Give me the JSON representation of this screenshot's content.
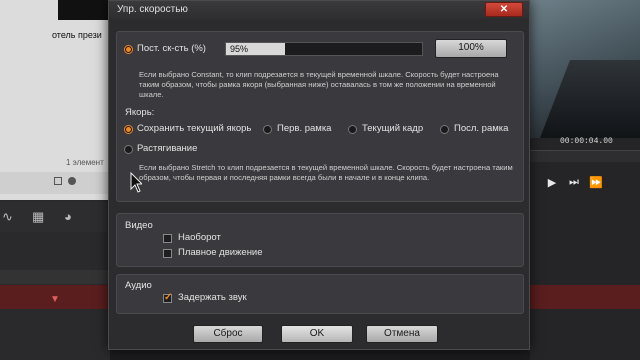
{
  "background": {
    "left_clip_title": "отель прези",
    "left_count": "1 элемент",
    "timecode": "00:00:04.00",
    "tb_icons": [
      "wave-icon",
      "grid-icon",
      "color-wheel-icon"
    ],
    "controls": [
      "▶",
      "⏭",
      "⏩"
    ],
    "right_playhead": "▼"
  },
  "dialog": {
    "title": "Упр. скоростью",
    "close_label": "✕",
    "speed": {
      "constant_label": "Пост. ск-сть (%)",
      "value_text": "95%",
      "fill_fraction": 0.3,
      "reset100_label": "100%",
      "constant_desc": "Если выбрано Constant, то клип подрезается в текущей временной шкале. Скорость будет настроена таким образом, чтобы рамка якоря (выбранная ниже) оставалась в том же положении на временной шкале.",
      "anchor_heading": "Якорь:",
      "anchors": [
        {
          "label": "Сохранить текущий якорь",
          "selected": true
        },
        {
          "label": "Перв. рамка",
          "selected": false
        },
        {
          "label": "Текущий кадр",
          "selected": false
        },
        {
          "label": "Посл. рамка",
          "selected": false
        }
      ],
      "stretch_label": "Растягивание",
      "stretch_desc": "Если выбрано Stretch то клип подрезается в текущей временной шкале. Скорость будет настроена таким образом, чтобы первая и последняя рамки всегда были в начале и в конце клипа."
    },
    "video": {
      "heading": "Видео",
      "reverse_label": "Наоборот",
      "smooth_label": "Плавное движение",
      "reverse_checked": false,
      "smooth_checked": false
    },
    "audio": {
      "heading": "Аудио",
      "hold_label": "Задержать звук",
      "hold_checked": true
    },
    "buttons": {
      "reset": "Сброс",
      "ok": "OK",
      "cancel": "Отмена"
    }
  },
  "colors": {
    "accent": "#f08a1c",
    "close": "#c23a2a",
    "dialog_bg": "#2c2c2f"
  }
}
